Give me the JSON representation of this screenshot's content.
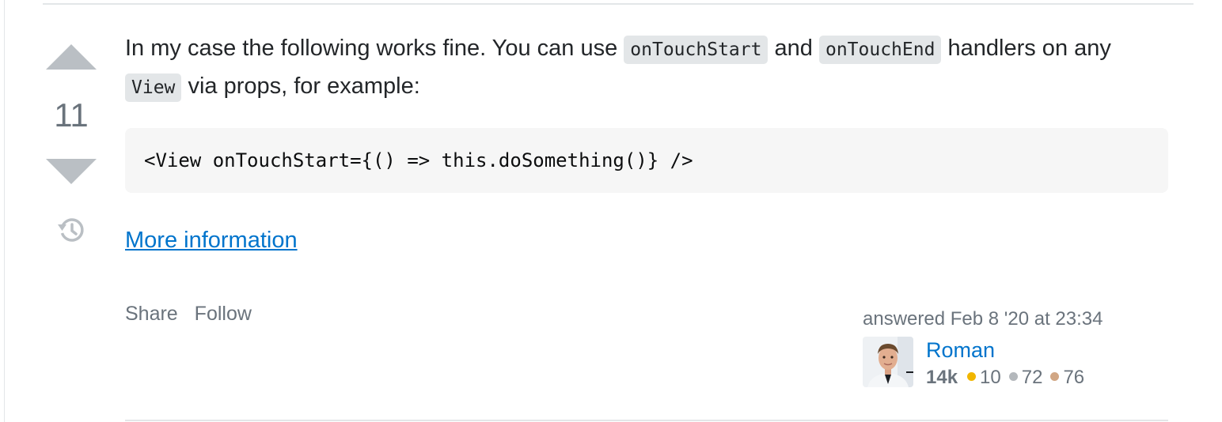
{
  "vote": {
    "count": "11",
    "up_icon": "upvote-arrow-icon",
    "down_icon": "downvote-arrow-icon",
    "history_icon": "history-icon"
  },
  "answer": {
    "text_1": "In my case the following works fine. You can use ",
    "code_1": "onTouchStart",
    "text_2": " and ",
    "code_2": "onTouchEnd",
    "text_3": " handlers on any ",
    "code_3": "View",
    "text_4": " via props, for example:",
    "code_block": "<View onTouchStart={() => this.doSomething()} />",
    "link_label": "More information"
  },
  "actions": {
    "share_label": "Share",
    "follow_label": "Follow"
  },
  "user": {
    "answered_text": "answered Feb 8 '20 at 23:34",
    "name": "Roman",
    "reputation": "14k",
    "gold_badges": "10",
    "silver_badges": "72",
    "bronze_badges": "76"
  },
  "colors": {
    "gold": "#f1b600",
    "silver": "#9a9c9f",
    "bronze": "#ab825f",
    "link": "#0074cc"
  }
}
